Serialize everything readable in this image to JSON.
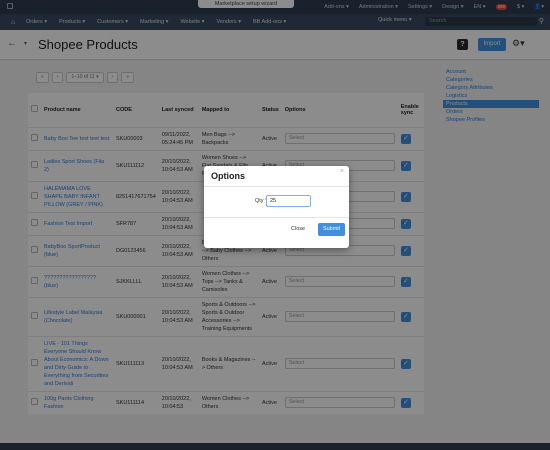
{
  "topbar": {
    "wizard_label": "Marketplace setup wizard",
    "right_items": [
      "Add-ons ▾",
      "Administration ▾",
      "Settings ▾",
      "Design ▾",
      "EN ▾",
      "$ ▾"
    ],
    "badge": "999"
  },
  "menu": {
    "items": [
      "Orders ▾",
      "Products ▾",
      "Customers ▾",
      "Marketing ▾",
      "Website ▾",
      "Vendors ▾",
      "BB Add-ons ▾"
    ],
    "quick_menu": "Quick menu ▾",
    "search_placeholder": "Search"
  },
  "title": {
    "heading": "Shopee Products",
    "import_label": "Import"
  },
  "pager": [
    "«",
    "‹",
    "1–10 of 11 ▾",
    "›",
    "»"
  ],
  "table": {
    "headers": [
      "Product name",
      "CODE",
      "Last synced",
      "Mapped to",
      "Status",
      "Options",
      "Enable sync"
    ],
    "rows": [
      {
        "name": "Baby Boo Tee test test test",
        "code": "SKU00003",
        "synced": "09/11/2022, 05:24:45 PM",
        "mapped": "Men Bags --> Backpacks",
        "status": "Active",
        "option": "Select"
      },
      {
        "name": "Ladies Sport Shoes (Fila 2)",
        "code": "SKU111112",
        "synced": "20/10/2022, 10:04:53 AM",
        "mapped": "Women Shoes --> Flat Sandals & Flip Flops",
        "status": "Active",
        "option": "Select"
      },
      {
        "name": "HALEMAMA LOVE SHAPE BABY INFANT PILLOW (GREY / PINK)",
        "code": "8251417671754",
        "synced": "20/10/2022, 10:04:53 AM",
        "mapped": "",
        "status": "",
        "option": "Select"
      },
      {
        "name": "Fashion Test Import",
        "code": "SFR787",
        "synced": "20/10/2022, 10:04:53 AM",
        "mapped": "",
        "status": "",
        "option": "Select"
      },
      {
        "name": "BabyBoo SportProduct (blue)",
        "code": "DG0123456",
        "synced": "20/10/2022, 10:04:53 AM",
        "mapped": "Baby & Kids Fashion --> Baby Clothes --> Others",
        "status": "Active",
        "option": "Select"
      },
      {
        "name": "????????????????? (blue)",
        "code": "SJKKLLLL",
        "synced": "20/10/2022, 10:04:53 AM",
        "mapped": "Women Clothes --> Tops --> Tanks & Camisoles",
        "status": "Active",
        "option": "Select"
      },
      {
        "name": "Lifestyle Label Malaysia (Chocolate)",
        "code": "SKU000001",
        "synced": "20/10/2022, 10:04:53 AM",
        "mapped": "Sports & Outdoors --> Sports & Outdoor Accessories --> Training Equipments",
        "status": "Active",
        "option": "Select"
      },
      {
        "name": "LIVE - 101 Things Everyone Should Know About Economics: A Down and Dirty Guide to Everything from Securities and Derivati",
        "code": "SKU111113",
        "synced": "20/10/2022, 10:04:53 AM",
        "mapped": "Books & Magazines --> Others",
        "status": "Active",
        "option": "Select"
      },
      {
        "name": "100g Pants Clothing Fashion",
        "code": "SKU111114",
        "synced": "20/10/2022, 10:04:53",
        "mapped": "Women Clothes --> Others",
        "status": "Active",
        "option": "Select"
      }
    ]
  },
  "sidebar": [
    "Account",
    "Categories",
    "Category Attributes",
    "Logistics",
    "Products",
    "Orders",
    "Shopee Profiles"
  ],
  "sidebar_active": "Products",
  "modal": {
    "title": "Options",
    "qty_label": "Qty *",
    "qty_value": "25",
    "close_label": "Close",
    "submit_label": "Submit"
  },
  "colors": {
    "accent": "#3f91e0",
    "topbar": "#2f3d51",
    "link": "#2f7bd9"
  }
}
